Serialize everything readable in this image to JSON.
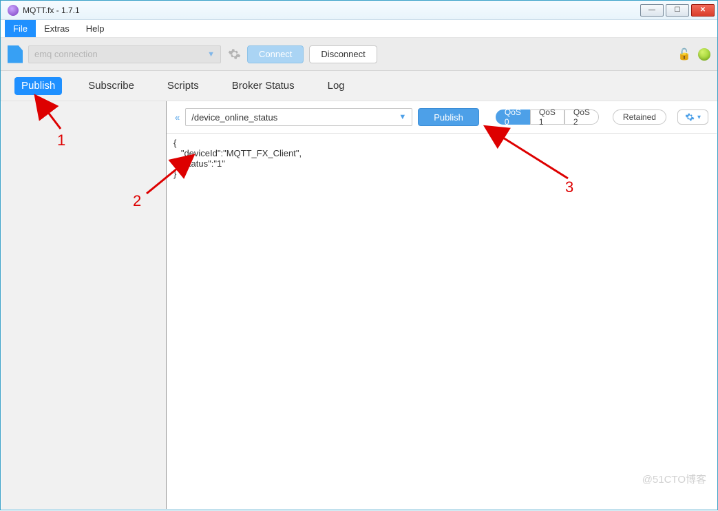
{
  "window": {
    "title": "MQTT.fx - 1.7.1"
  },
  "menubar": {
    "file": "File",
    "extras": "Extras",
    "help": "Help"
  },
  "connection": {
    "profile_placeholder": "emq connection",
    "connect_label": "Connect",
    "disconnect_label": "Disconnect"
  },
  "tabs": {
    "publish": "Publish",
    "subscribe": "Subscribe",
    "scripts": "Scripts",
    "broker_status": "Broker Status",
    "log": "Log"
  },
  "publish": {
    "topic": "/device_online_status",
    "publish_label": "Publish",
    "qos": {
      "qos0": "QoS 0",
      "qos1": "QoS 1",
      "qos2": "QoS 2"
    },
    "retained_label": "Retained",
    "payload": "{\n   \"deviceId\":\"MQTT_FX_Client\",\n   \"status\":\"1\"\n}"
  },
  "annotations": {
    "a1": "1",
    "a2": "2",
    "a3": "3"
  },
  "watermark": "@51CTO博客"
}
